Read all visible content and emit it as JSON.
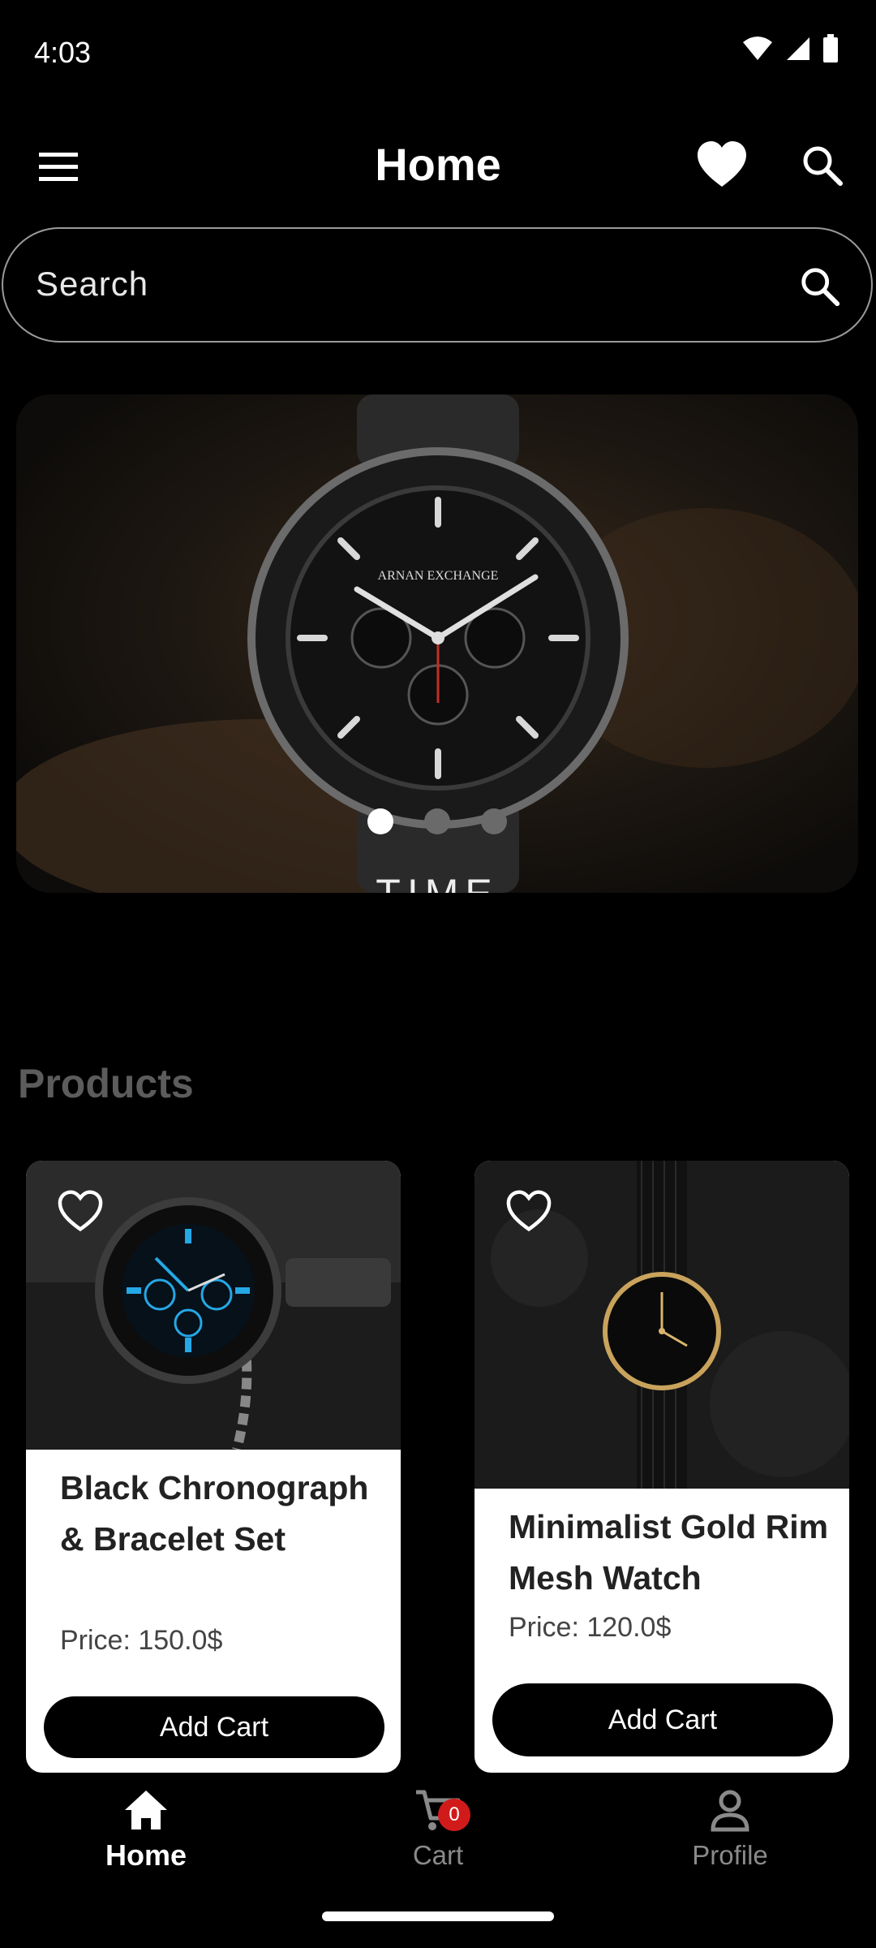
{
  "status_bar": {
    "time": "4:03"
  },
  "app_bar": {
    "title": "Home"
  },
  "search": {
    "placeholder": "Search"
  },
  "banner": {
    "caption": "TIME",
    "active_index": 0,
    "count": 3
  },
  "products_section": {
    "title": "Products"
  },
  "products": [
    {
      "name": "Black Chronograph & Bracelet Set",
      "price": "Price: 150.0$",
      "button": "Add Cart"
    },
    {
      "name": "Minimalist Gold Rim Mesh Watch",
      "price": "Price: 120.0$",
      "button": "Add Cart"
    }
  ],
  "bottom_nav": {
    "items": [
      {
        "label": "Home",
        "icon": "home-icon",
        "active": true
      },
      {
        "label": "Cart",
        "icon": "cart-icon",
        "active": false,
        "badge": "0"
      },
      {
        "label": "Profile",
        "icon": "profile-icon",
        "active": false
      }
    ]
  },
  "colors": {
    "background": "#000000",
    "badge": "#d11b1b",
    "inactive": "#8a8a8a"
  }
}
